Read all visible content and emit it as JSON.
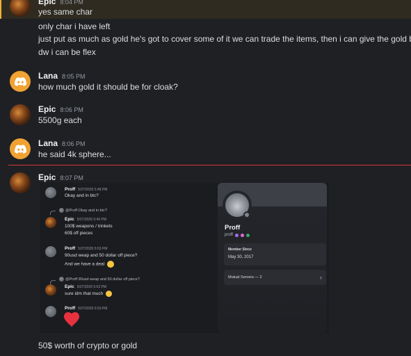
{
  "messages": [
    {
      "user": "Epic",
      "time": "8:04 PM",
      "lines": [
        "yes same char",
        "only char i have left",
        "just put as much as gold he's got to cover some of it we can trade the items, then i can give the gold back",
        "dw i can be flex"
      ]
    },
    {
      "user": "Lana",
      "time": "8:05 PM",
      "lines": [
        "how much gold it should be for cloak?"
      ]
    },
    {
      "user": "Epic",
      "time": "8:06 PM",
      "lines": [
        "5500g each"
      ]
    },
    {
      "user": "Lana",
      "time": "8:06 PM",
      "lines": [
        "he said 4k sphere..."
      ]
    },
    {
      "user": "Epic",
      "time": "8:07 PM",
      "lines": [
        "50$ worth of crypto or gold"
      ]
    }
  ],
  "embedded": {
    "messages": [
      {
        "user": "Proff",
        "time": "5/27/2026 5:48 PM",
        "lines": [
          "Okay and in btc?"
        ]
      },
      {
        "reply": "@Proff Okay and in btc?",
        "user": "Epic",
        "time": "5/27/2026 5:49 PM",
        "lines": [
          "100$ weapons / trinkets",
          "60$ off pieces"
        ]
      },
      {
        "user": "Proff",
        "time": "5/27/2026 5:53 PM",
        "lines": [
          "90usd weap and 50 dollar off piece?",
          "And we have a deal"
        ]
      },
      {
        "reply": "@Proff 90usd weap and 50 dollar off piece?",
        "user": "Epic",
        "time": "5/27/2026 5:53 PM",
        "lines": [
          "sure idm that much"
        ]
      },
      {
        "user": "Proff",
        "time": "5/27/2026 5:53 PM",
        "lines": [
          "❤️"
        ]
      }
    ],
    "profile": {
      "display_name": "Proff",
      "username": "proff",
      "member_since_label": "Member Since",
      "member_since": "May 30, 2017",
      "mutual_servers": "Mutual Servers — 2"
    }
  },
  "colors": {
    "accent_red": "#d13a3a",
    "lana_avatar": "#f0a232",
    "highlight": "#f0b232"
  }
}
